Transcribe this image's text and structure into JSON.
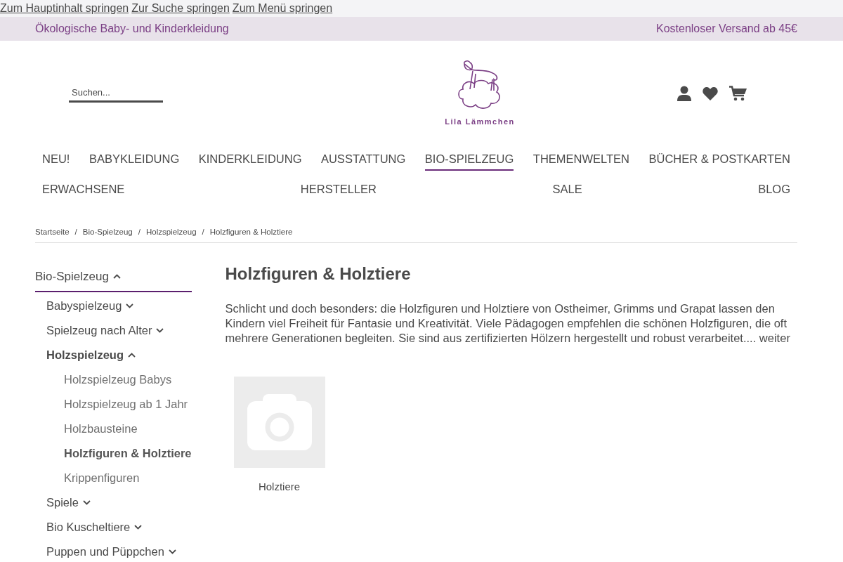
{
  "skip_links": [
    "Zum Hauptinhalt springen",
    "Zur Suche springen",
    "Zum Menü springen"
  ],
  "top_bar": {
    "left": "Ökologische Baby- und Kinderkleidung",
    "right": "Kostenloser Versand ab 45€"
  },
  "search": {
    "placeholder": "Suchen..."
  },
  "logo": {
    "text": "Lila Lämmchen"
  },
  "nav": {
    "items": [
      {
        "label": "NEU!",
        "selected": false
      },
      {
        "label": "BABYKLEIDUNG",
        "selected": false
      },
      {
        "label": "KINDERKLEIDUNG",
        "selected": false
      },
      {
        "label": "AUSSTATTUNG",
        "selected": false
      },
      {
        "label": "BIO-SPIELZEUG",
        "selected": true
      },
      {
        "label": "THEMENWELTEN",
        "selected": false
      },
      {
        "label": "BÜCHER & POSTKARTEN",
        "selected": false
      },
      {
        "label": "ERWACHSENE",
        "selected": false
      },
      {
        "label": "HERSTELLER",
        "selected": false
      },
      {
        "label": "SALE",
        "selected": false
      },
      {
        "label": "BLOG",
        "selected": false
      }
    ]
  },
  "breadcrumb": {
    "items": [
      "Startseite",
      "Bio-Spielzeug",
      "Holzspielzeug",
      "Holzfiguren & Holztiere"
    ],
    "separators": [
      "/",
      "/",
      "/"
    ]
  },
  "sidebar": {
    "items": [
      {
        "label": "Bio-Spielzeug",
        "kind": "folder",
        "expanded": true,
        "children": [
          {
            "label": "Babyspielzeug",
            "kind": "folder",
            "expanded": false
          },
          {
            "label": "Spielzeug nach Alter",
            "kind": "folder",
            "expanded": false
          },
          {
            "label": "Holzspielzeug",
            "kind": "folder",
            "expanded": true,
            "children": [
              {
                "label": "Holzspielzeug Babys",
                "kind": "leaf",
                "selected": false
              },
              {
                "label": "Holzspielzeug ab 1 Jahr",
                "kind": "leaf",
                "selected": false
              },
              {
                "label": "Holzbausteine",
                "kind": "leaf",
                "selected": false
              },
              {
                "label": "Holzfiguren & Holztiere",
                "kind": "leaf",
                "selected": true
              },
              {
                "label": "Krippenfiguren",
                "kind": "leaf",
                "selected": false
              }
            ]
          },
          {
            "label": "Spiele",
            "kind": "folder",
            "expanded": false
          },
          {
            "label": "Bio Kuscheltiere",
            "kind": "folder",
            "expanded": false
          },
          {
            "label": "Puppen und Püppchen",
            "kind": "folder",
            "expanded": false
          }
        ]
      }
    ]
  },
  "content": {
    "title": "Holzfiguren & Holztiere",
    "description": "Schlicht und doch besonders: die Holzfiguren und Holztiere von Ostheimer, Grimms und Grapat lassen den Kindern viel Freiheit für Fantasie und Kreativität. Viele Pädagogen empfehlen die schönen Holzfiguren, die oft mehrere Generationen begleiten. Sie sind aus zertifizierten Hölzern hergestellt und robust verarbeitet....",
    "more_link": "weiter",
    "categories": [
      {
        "label": "Holztiere"
      }
    ]
  }
}
